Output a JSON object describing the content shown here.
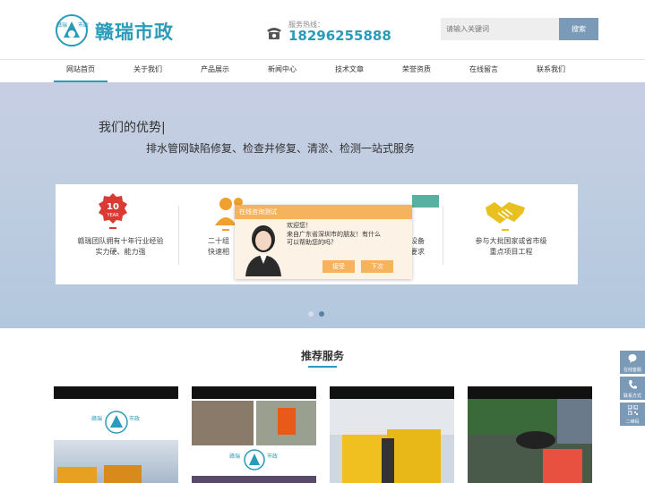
{
  "header": {
    "logo_text": "赣瑞市政",
    "logo_seal": "赣瑞 市政",
    "phone_label": "服务热线：",
    "phone_number": "18296255888",
    "search_placeholder": "请输入关键词",
    "search_button": "搜索"
  },
  "nav": {
    "items": [
      {
        "label": "网站首页"
      },
      {
        "label": "关于我们"
      },
      {
        "label": "产品展示"
      },
      {
        "label": "新闻中心"
      },
      {
        "label": "技术文章"
      },
      {
        "label": "荣誉资质"
      },
      {
        "label": "在线留言"
      },
      {
        "label": "联系我们"
      }
    ],
    "active_index": 0
  },
  "banner": {
    "heading": "我们的优势|",
    "subheading": "排水管网缺陷修复、检查井修复、清淤、检测一站式服务",
    "advantages": [
      {
        "badge_number": "10",
        "badge_word": "YEAR",
        "line1": "赣瑞团队拥有十年行业经验",
        "line2": "实力硬、能力强"
      },
      {
        "line1": "二十组",
        "line2": "快速相"
      },
      {
        "line1": "设备",
        "line2": "要求"
      },
      {
        "line1": "参与大批国家或省市级",
        "line2": "重点项目工程"
      }
    ],
    "slide_count": 2,
    "active_slide": 1
  },
  "chat": {
    "title": "在线咨询测试",
    "message_line1": "欢迎您！",
    "message_line2": "来自广东省深圳市的朋友！有什么",
    "message_line3": "可以帮助您的吗？",
    "accept_label": "接受",
    "later_label": "下次"
  },
  "services": {
    "title": "推荐服务",
    "card_logo_text": "赣瑞 市政"
  },
  "side_float": [
    {
      "label": "在线客服",
      "icon": "chat-bubble-icon"
    },
    {
      "label": "联系方式",
      "icon": "phone-icon"
    },
    {
      "label": "二维码",
      "icon": "qr-code-icon"
    }
  ],
  "colors": {
    "brand": "#2a9bb8",
    "accent_button": "#7b9ab8",
    "chat_orange": "#f5b35e",
    "badge_red": "#d93a34",
    "icon_orange": "#f0a030",
    "icon_yellow": "#e8c020"
  }
}
